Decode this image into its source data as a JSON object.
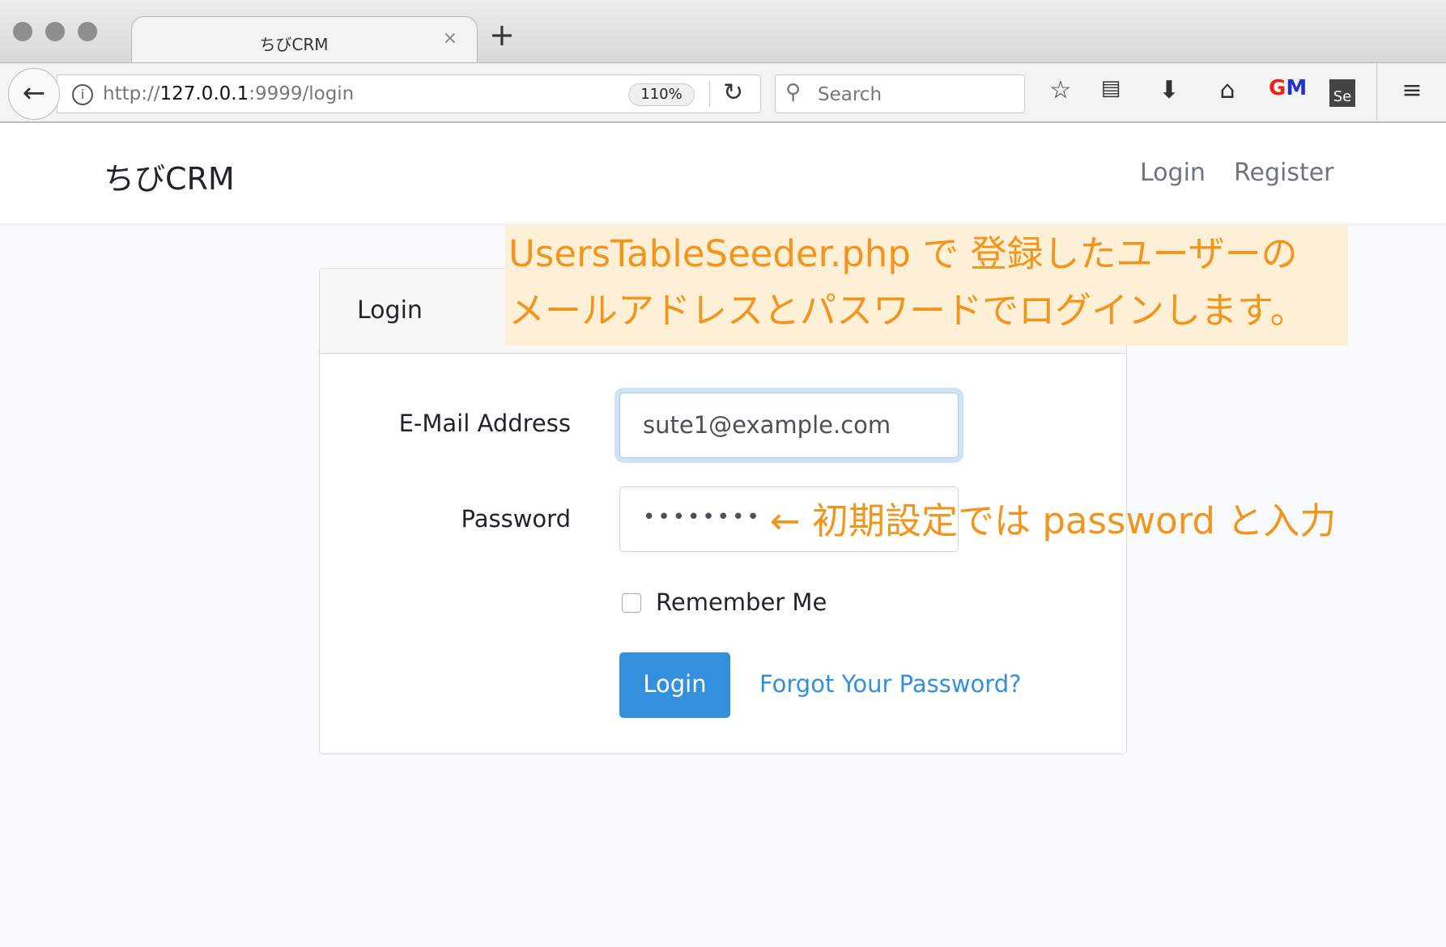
{
  "browser": {
    "tab_title": "ちびCRM",
    "tab_close": "×",
    "new_tab": "+",
    "url_prefix": "http://",
    "url_host": "127.0.0.1",
    "url_rest": ":9999/login",
    "zoom": "110%",
    "search_placeholder": "Search"
  },
  "navbar": {
    "brand": "ちびCRM",
    "links": [
      {
        "label": "Login"
      },
      {
        "label": "Register"
      }
    ]
  },
  "card": {
    "title": "Login",
    "email_label": "E-Mail Address",
    "email_value": "sute1@example.com",
    "password_label": "Password",
    "password_value": "••••••••",
    "remember_label": "Remember Me",
    "remember_checked": false,
    "login_button": "Login",
    "forgot_link": "Forgot Your Password?"
  },
  "annotations": {
    "line1": "UsersTableSeeder.php で 登録したユーザーの",
    "line2": "メールアドレスとパスワードでログインします。",
    "password_note": "← 初期設定では password  と入力"
  },
  "colors": {
    "accent": "#3490dc",
    "annotation": "#f3951c",
    "annotation_bg": "#fdf0d6"
  }
}
